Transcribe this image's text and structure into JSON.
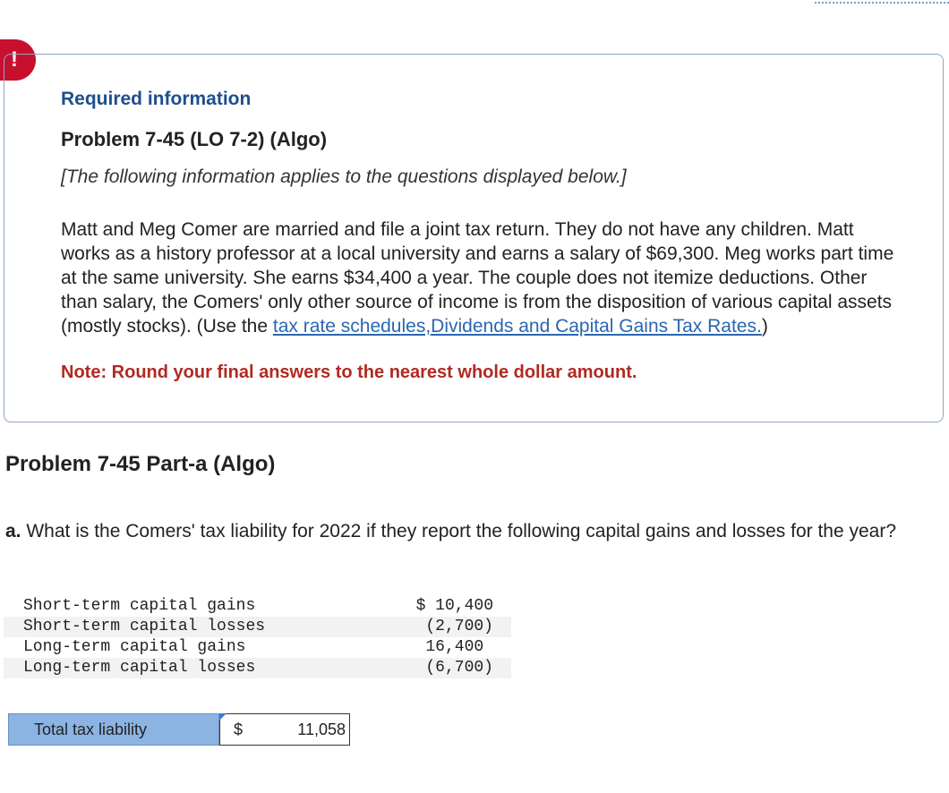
{
  "alert": {
    "symbol": "!"
  },
  "info": {
    "required_title": "Required information",
    "problem_title": "Problem 7-45 (LO 7-2) (Algo)",
    "applies_note": "[The following information applies to the questions displayed below.]",
    "paragraph_text": "Matt and Meg Comer are married and file a joint tax return. They do not have any children. Matt works as a history professor at a local university and earns a salary of $69,300. Meg works part time at the same university. She earns $34,400 a year. The couple does not itemize deductions. Other than salary, the Comers' only other source of income is from the disposition of various capital assets (mostly stocks). (Use the ",
    "link_tax_rate": "tax rate schedules,",
    "link_dividends": "Dividends and Capital Gains Tax Rates.",
    "paragraph_end": ")",
    "note": "Note: Round your final answers to the nearest whole dollar amount."
  },
  "part": {
    "title": "Problem 7-45 Part-a (Algo)",
    "question_letter": "a.",
    "question_text": " What is the Comers' tax liability for 2022 if they report the following capital gains and losses for the year?"
  },
  "capital_items": [
    {
      "label": "Short-term capital gains",
      "value": "$ 10,400"
    },
    {
      "label": "Short-term capital losses",
      "value": "(2,700)"
    },
    {
      "label": "Long-term capital gains",
      "value": "16,400 "
    },
    {
      "label": "Long-term capital losses",
      "value": "(6,700)"
    }
  ],
  "answer": {
    "label": "Total tax liability",
    "currency": "$",
    "value": "11,058"
  }
}
